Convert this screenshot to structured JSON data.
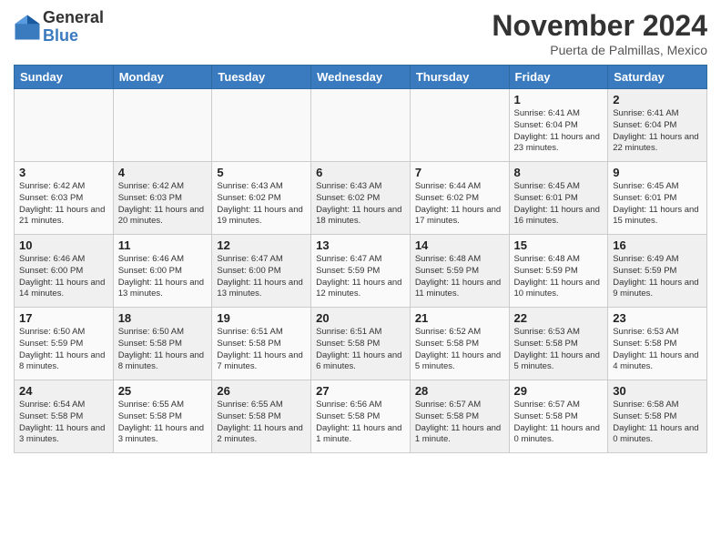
{
  "header": {
    "logo_general": "General",
    "logo_blue": "Blue",
    "month_title": "November 2024",
    "location": "Puerta de Palmillas, Mexico"
  },
  "weekdays": [
    "Sunday",
    "Monday",
    "Tuesday",
    "Wednesday",
    "Thursday",
    "Friday",
    "Saturday"
  ],
  "weeks": [
    [
      {
        "day": "",
        "info": ""
      },
      {
        "day": "",
        "info": ""
      },
      {
        "day": "",
        "info": ""
      },
      {
        "day": "",
        "info": ""
      },
      {
        "day": "",
        "info": ""
      },
      {
        "day": "1",
        "info": "Sunrise: 6:41 AM\nSunset: 6:04 PM\nDaylight: 11 hours and 23 minutes."
      },
      {
        "day": "2",
        "info": "Sunrise: 6:41 AM\nSunset: 6:04 PM\nDaylight: 11 hours and 22 minutes."
      }
    ],
    [
      {
        "day": "3",
        "info": "Sunrise: 6:42 AM\nSunset: 6:03 PM\nDaylight: 11 hours and 21 minutes."
      },
      {
        "day": "4",
        "info": "Sunrise: 6:42 AM\nSunset: 6:03 PM\nDaylight: 11 hours and 20 minutes."
      },
      {
        "day": "5",
        "info": "Sunrise: 6:43 AM\nSunset: 6:02 PM\nDaylight: 11 hours and 19 minutes."
      },
      {
        "day": "6",
        "info": "Sunrise: 6:43 AM\nSunset: 6:02 PM\nDaylight: 11 hours and 18 minutes."
      },
      {
        "day": "7",
        "info": "Sunrise: 6:44 AM\nSunset: 6:02 PM\nDaylight: 11 hours and 17 minutes."
      },
      {
        "day": "8",
        "info": "Sunrise: 6:45 AM\nSunset: 6:01 PM\nDaylight: 11 hours and 16 minutes."
      },
      {
        "day": "9",
        "info": "Sunrise: 6:45 AM\nSunset: 6:01 PM\nDaylight: 11 hours and 15 minutes."
      }
    ],
    [
      {
        "day": "10",
        "info": "Sunrise: 6:46 AM\nSunset: 6:00 PM\nDaylight: 11 hours and 14 minutes."
      },
      {
        "day": "11",
        "info": "Sunrise: 6:46 AM\nSunset: 6:00 PM\nDaylight: 11 hours and 13 minutes."
      },
      {
        "day": "12",
        "info": "Sunrise: 6:47 AM\nSunset: 6:00 PM\nDaylight: 11 hours and 13 minutes."
      },
      {
        "day": "13",
        "info": "Sunrise: 6:47 AM\nSunset: 5:59 PM\nDaylight: 11 hours and 12 minutes."
      },
      {
        "day": "14",
        "info": "Sunrise: 6:48 AM\nSunset: 5:59 PM\nDaylight: 11 hours and 11 minutes."
      },
      {
        "day": "15",
        "info": "Sunrise: 6:48 AM\nSunset: 5:59 PM\nDaylight: 11 hours and 10 minutes."
      },
      {
        "day": "16",
        "info": "Sunrise: 6:49 AM\nSunset: 5:59 PM\nDaylight: 11 hours and 9 minutes."
      }
    ],
    [
      {
        "day": "17",
        "info": "Sunrise: 6:50 AM\nSunset: 5:59 PM\nDaylight: 11 hours and 8 minutes."
      },
      {
        "day": "18",
        "info": "Sunrise: 6:50 AM\nSunset: 5:58 PM\nDaylight: 11 hours and 8 minutes."
      },
      {
        "day": "19",
        "info": "Sunrise: 6:51 AM\nSunset: 5:58 PM\nDaylight: 11 hours and 7 minutes."
      },
      {
        "day": "20",
        "info": "Sunrise: 6:51 AM\nSunset: 5:58 PM\nDaylight: 11 hours and 6 minutes."
      },
      {
        "day": "21",
        "info": "Sunrise: 6:52 AM\nSunset: 5:58 PM\nDaylight: 11 hours and 5 minutes."
      },
      {
        "day": "22",
        "info": "Sunrise: 6:53 AM\nSunset: 5:58 PM\nDaylight: 11 hours and 5 minutes."
      },
      {
        "day": "23",
        "info": "Sunrise: 6:53 AM\nSunset: 5:58 PM\nDaylight: 11 hours and 4 minutes."
      }
    ],
    [
      {
        "day": "24",
        "info": "Sunrise: 6:54 AM\nSunset: 5:58 PM\nDaylight: 11 hours and 3 minutes."
      },
      {
        "day": "25",
        "info": "Sunrise: 6:55 AM\nSunset: 5:58 PM\nDaylight: 11 hours and 3 minutes."
      },
      {
        "day": "26",
        "info": "Sunrise: 6:55 AM\nSunset: 5:58 PM\nDaylight: 11 hours and 2 minutes."
      },
      {
        "day": "27",
        "info": "Sunrise: 6:56 AM\nSunset: 5:58 PM\nDaylight: 11 hours and 1 minute."
      },
      {
        "day": "28",
        "info": "Sunrise: 6:57 AM\nSunset: 5:58 PM\nDaylight: 11 hours and 1 minute."
      },
      {
        "day": "29",
        "info": "Sunrise: 6:57 AM\nSunset: 5:58 PM\nDaylight: 11 hours and 0 minutes."
      },
      {
        "day": "30",
        "info": "Sunrise: 6:58 AM\nSunset: 5:58 PM\nDaylight: 11 hours and 0 minutes."
      }
    ]
  ]
}
